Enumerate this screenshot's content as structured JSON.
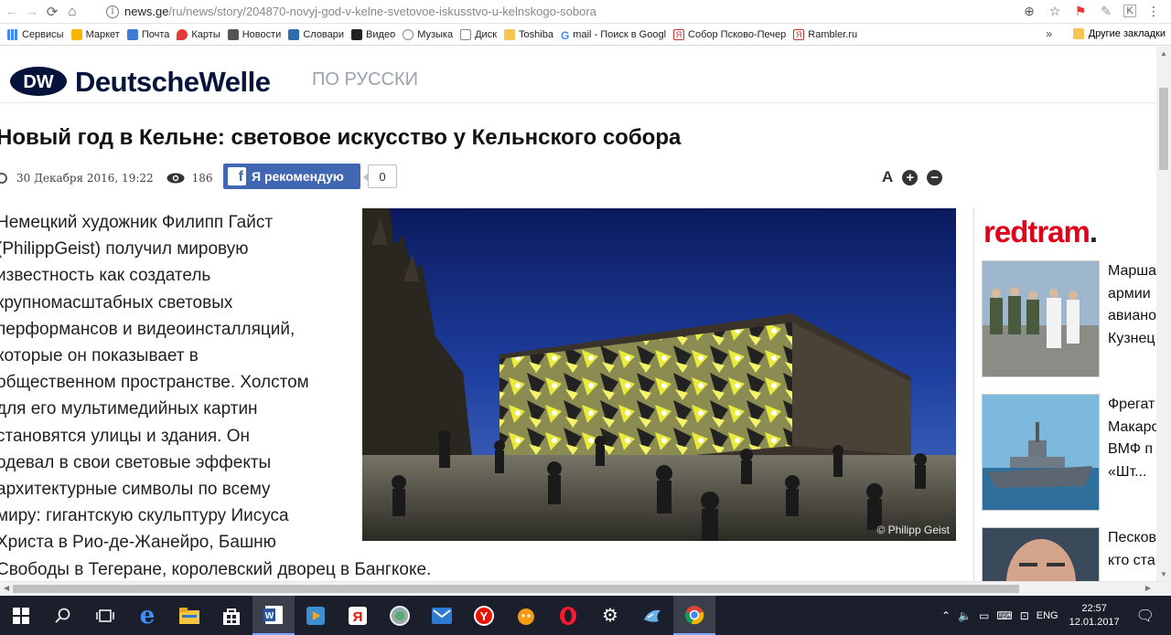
{
  "browser": {
    "url_host": "news.ge",
    "url_path": "/ru/news/story/204870-novyj-god-v-kelne-svetovoe-iskusstvo-u-kelnskogo-sobora",
    "bookmarks": [
      "Сервисы",
      "Маркет",
      "Почта",
      "Карты",
      "Новости",
      "Словари",
      "Видео",
      "Музыка",
      "Диск",
      "Toshiba",
      "mail - Поиск в Googl",
      "Собор Псково-Печер",
      "Rambler.ru"
    ],
    "bookmarks_more": "»",
    "other_bookmarks": "Другие закладки"
  },
  "site": {
    "brand": "DeutscheWelle",
    "lang": "ПО РУССКИ"
  },
  "article": {
    "title": "Новый год в Кельне: световое искусство у Кельнского собора",
    "date": "30 Декабря 2016, 19:22",
    "views": "186",
    "fb_label": "Я рекомендую",
    "fb_count": "0",
    "font_label": "A",
    "body_lines": [
      "Немецкий художник Филипп Гайст",
      "(PhilippGeist) получил мировую",
      "известность как создатель",
      "крупномасштабных световых",
      "перформансов и видеоинсталляций,",
      "которые он показывает в",
      "общественном пространстве. Холстом",
      "для его мультимедийных картин",
      "становятся улицы и здания. Он",
      "одевал в свои световые эффекты",
      "архитектурные символы по всему",
      "миру: гигантскую скульптуру Иисуса",
      "Христа в Рио-де-Жанейро, Башню",
      "Свободы в Тегеране, королевский дворец в Бангкоке."
    ],
    "photo_credit": "© Philipp Geist"
  },
  "redtram": {
    "logo": "redtram",
    "logo_dot": ".",
    "items": [
      {
        "lines": [
          "Марша",
          "армии",
          "авиано",
          "Кузнец"
        ]
      },
      {
        "lines": [
          "Фрегат",
          "Макаро",
          "ВМФ п",
          "«Шт..."
        ]
      },
      {
        "lines": [
          "Песков",
          "кто ста"
        ]
      }
    ]
  },
  "taskbar": {
    "lang": "ENG",
    "time": "22:57",
    "date": "12.01.2017"
  }
}
